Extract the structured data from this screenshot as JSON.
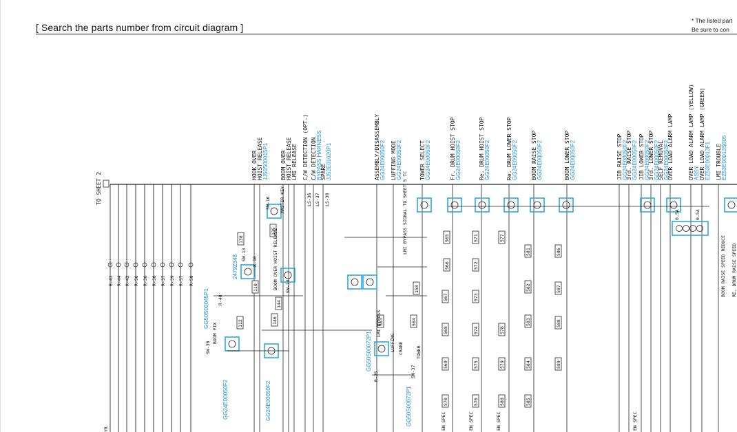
{
  "header": {
    "title": "[ Search the parts number from circuit diagram ]",
    "note_line1": "* The listed part",
    "note_line2": "Be sure to con"
  },
  "colors": {
    "wire": "#222222",
    "highlight": "#29a8e0",
    "part_number": "#1a8fd6"
  },
  "diagram": {
    "sheet_label": "TO SHEET 2",
    "functions": [
      {
        "text": "HOOK OVER",
        "pn": ""
      },
      {
        "text": "HOIST RELEASE",
        "pn": "JJ50S00015P1"
      },
      {
        "text": "BOOM OVER",
        "pn": ""
      },
      {
        "text": "HOIST RELEASE",
        "pn": ""
      },
      {
        "text": "LMI RELEASE",
        "pn": ""
      },
      {
        "text": "C/W DETECTION (OPT.)",
        "pn": ""
      },
      {
        "text": "C/W DETECTION",
        "pn": "BYPASS HARNESS"
      },
      {
        "text": "SPARE",
        "pn": "JJ52E01020P1"
      },
      {
        "text": "ASSEMBLY/DISASSEMBLY",
        "pn": "GG24E00050F2"
      },
      {
        "text": "LUFFING MODE",
        "pn": "GG24E00050F2"
      },
      {
        "text": "TOWER SELECT",
        "pn": "GG24E00050F2"
      },
      {
        "text": "Fr. DRUM HOIST STOP",
        "pn": "GG24E00050F2"
      },
      {
        "text": "Re. DRUM HOIST STOP",
        "pn": "GG24E00050F2"
      },
      {
        "text": "Re. DRUM LOWER STOP",
        "pn": "GG24E00050F2"
      },
      {
        "text": "BOOM RAISE STOP",
        "pn": "GG24E00050F2"
      },
      {
        "text": "BOOM LOWER STOP",
        "pn": "GG24E00050F2"
      },
      {
        "text": "JIB RAISE STOP",
        "pn": "GG24E00050F2"
      },
      {
        "text": "3rd. RAISE STOP",
        "pn": "GG24E00050F2"
      },
      {
        "text": "JIB LOWER STOP",
        "pn": "GG24E00050F2"
      },
      {
        "text": "3rd. LOWER STOP",
        "pn": "GG24E00050F2"
      },
      {
        "text": "SELF REMOVAL",
        "pn": "GG24E00050F2"
      },
      {
        "text": "OVER LOAD ALARM LAMP",
        "pn": ""
      },
      {
        "text": "OVER LOAD ALARM LAMP (YELLOW)",
        "pn": "ASSY"
      },
      {
        "text": "OVER LOAD ALARM LAMP (GREEN)",
        "pn": "EZ53E00013F1"
      },
      {
        "text": "LMI TROUBLE",
        "pn": "EZ53E00013S005"
      }
    ],
    "left_signals": [
      "R-43",
      "R-44",
      "R-42",
      "R-56",
      "R-36",
      "R-38",
      "R-37",
      "R-39",
      "R-57",
      "R-58"
    ],
    "relays": [
      "SW-30",
      "BOOM FIX",
      "R-48",
      "R-10",
      "SW-13",
      "BOOM OVER HOIST RELEASE",
      "SW-16",
      "MASTER KEY",
      "LS-36",
      "LS-37",
      "LS-38",
      "SW-14",
      "SW-37",
      "CRANE",
      "LUFFING",
      "TOWER",
      "LMI BYPASS SIGNAL TO SHEET 5 TC",
      "R-25",
      "LMI BYPASS",
      "BOOM RAISE SPEED REDUCE",
      "RE. DRUM RAISE SPEED"
    ],
    "wire_tags": [
      "138",
      "110",
      "112",
      "135",
      "144",
      "146",
      "158",
      "563",
      "564",
      "565",
      "566",
      "567",
      "568",
      "569",
      "570",
      "571",
      "572",
      "573",
      "574",
      "575",
      "576",
      "577",
      "578",
      "579",
      "580",
      "581",
      "582",
      "583",
      "584",
      "585",
      "586",
      "587",
      "588",
      "589"
    ],
    "bottom_tags": [
      "EN SPEC",
      "EN SPEC",
      "EN SPEC",
      "EN SPEC"
    ],
    "blue_part_numbers": [
      "GG50S00045P1",
      "GG24E00050F2",
      "2479Z348",
      "GG24E00050F2",
      "GG50S00072P1",
      "GG50S00072P1"
    ],
    "fuses": [
      "0.5A",
      "0.5A"
    ],
    "yr_label": "YR"
  }
}
